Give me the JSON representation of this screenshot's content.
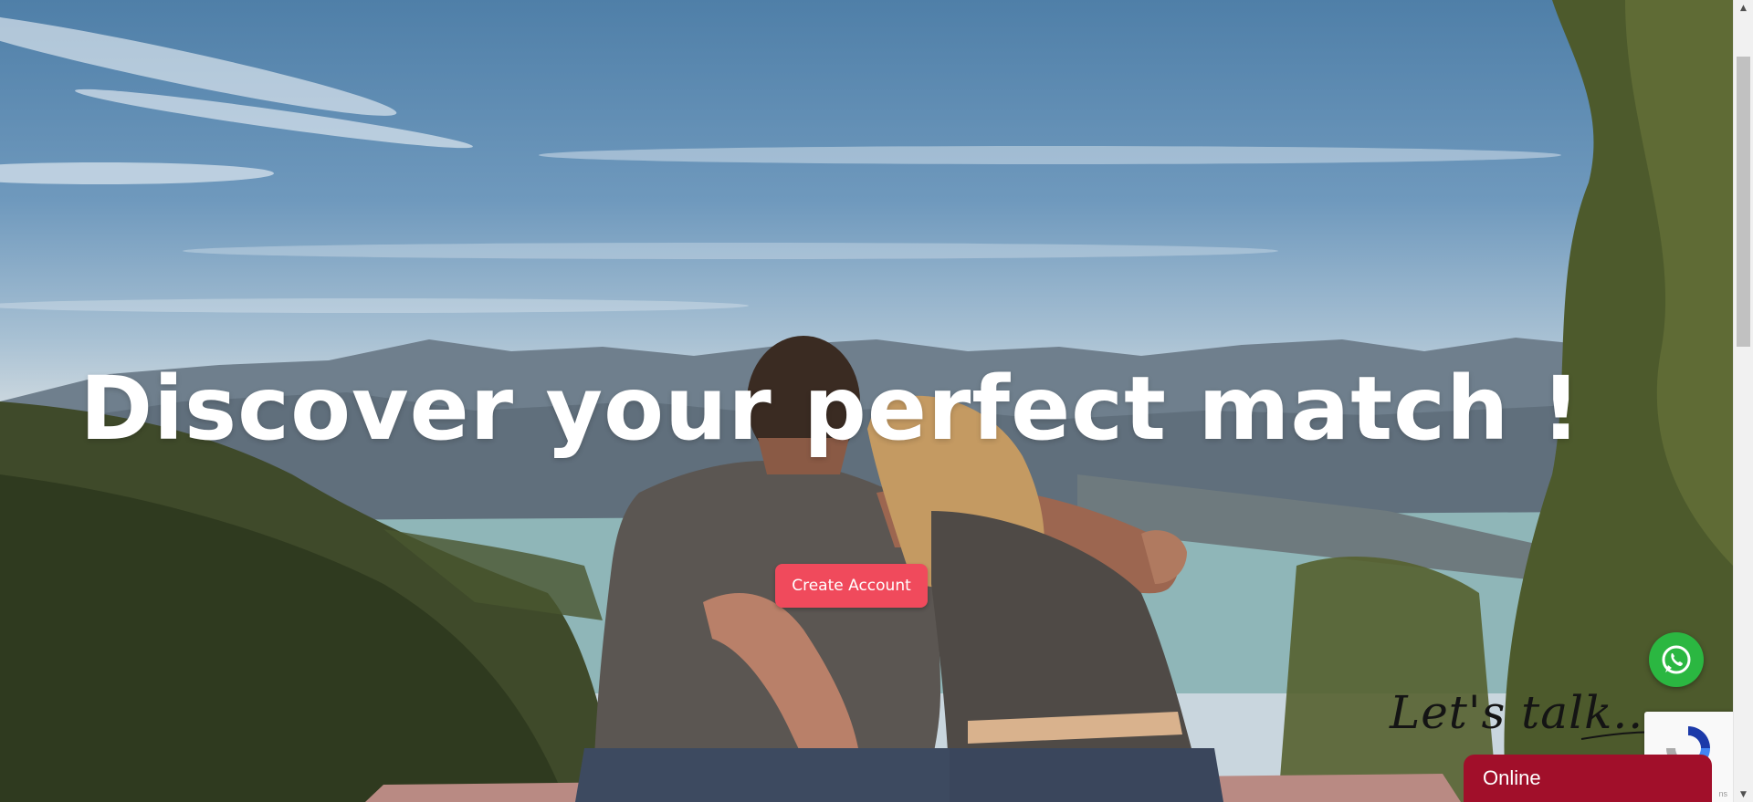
{
  "hero": {
    "title": "Discover your perfect match !",
    "cta_label": "Create Account"
  },
  "whatsapp": {
    "icon": "whatsapp-icon"
  },
  "chat": {
    "prompt": "Let's talk...",
    "status": "Online"
  },
  "recaptcha": {
    "icon": "recaptcha-icon",
    "terms_label": "ns"
  },
  "colors": {
    "accent": "#f04a5c",
    "chat_bar": "#a10f2a",
    "whatsapp": "#2bb741"
  }
}
